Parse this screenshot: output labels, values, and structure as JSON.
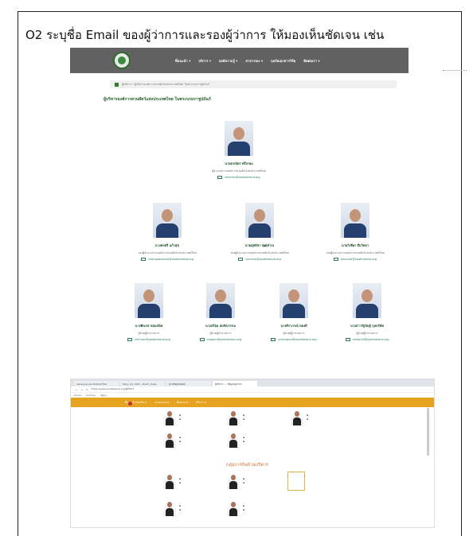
{
  "heading": "O2 ระบุชื่อ Email ของผู้ว่าการและรองผู้ว่าการ ให้มองเห็นชัดเจน เช่น",
  "site": {
    "menu": [
      "ที่แนะนำ ▾",
      "บริการ ▾",
      "องค์ความรู้ ▾",
      "สาธารณะ ▾",
      "บอร์ดเอกสารวิจัย",
      "ติดต่อเรา ▾"
    ],
    "breadcrumb": "ผู้บริหาร  /  ผู้บริหารองค์การสวนสัตว์แห่งประเทศไทย ในพระบรมราชูปถัมภ์",
    "page_title": "ผู้บริหารองค์การสวนสัตว์แห่งประเทศไทย ในพระบรมราชูปถัมภ์",
    "executives": [
      {
        "name": "นายธรณัตร ศรีเกษม",
        "role": "ผู้อำนวยการองค์การสวนสัตว์แห่งประเทศไทย",
        "email": "director@zoothailand.org"
      },
      {
        "name": "นางพรศรี แก้วสุข",
        "role": "รองผู้อำนวยการองค์การสวนสัตว์แห่งประเทศไทย",
        "email": "chompatdonno@zoothailand.org"
      },
      {
        "name": "นายสุทธิชา พุฒิดำรง",
        "role": "รองผู้อำนวยการองค์การสวนสัตว์แห่งประเทศไทย",
        "email": "sumana@zoothailand.org"
      },
      {
        "name": "นายวิเชียร สืบวิทยา",
        "role": "รองผู้อำนวยการองค์การสวนสัตว์แห่งประเทศไทย",
        "email": "wanchai@zoothailand.org"
      },
      {
        "name": "นางพิณรส หอมสนิท",
        "role": "ผู้ช่วยผู้อำนวยการ",
        "email": "sirinuan@zoothailand.org"
      },
      {
        "name": "นางสร้อย สมจิตวรรณ",
        "role": "ผู้ช่วยผู้อำนวยการ",
        "email": "buagen@zoothailand.org"
      },
      {
        "name": "นางศิราภรณ์ ทองดี",
        "role": "ผู้ช่วยผู้อำนวยการ",
        "email": "primawan@zoothailand.org"
      },
      {
        "name": "นางสาวรัฐนิษฐ์ กุลบริษัท",
        "role": "ผู้ช่วยผู้อำนวยการ",
        "email": "rostlandi@zoothailand.org"
      }
    ]
  },
  "browser": {
    "tabs": [
      "Library.ipu.ac.th/ZooTHAI",
      "Story (1) 1203 - Zoom_Hubs",
      "ฐานข้อมูลบุคคล",
      "ผู้บริหาร — ข้อมูลบุคลากร"
    ],
    "url": "https://www.zoothailand.org/ผู้บริหาร",
    "bookmarks": [
      "Gmail",
      "YouTube",
      "Maps"
    ],
    "nav": [
      "ที่แนะนำส่งเสริม ▾",
      "ผ่านระบบ ▾",
      "ติดตาม ▾",
      "บริการ ▾"
    ],
    "section_title": "กลุ่มการกิจด้านบริหาร"
  }
}
